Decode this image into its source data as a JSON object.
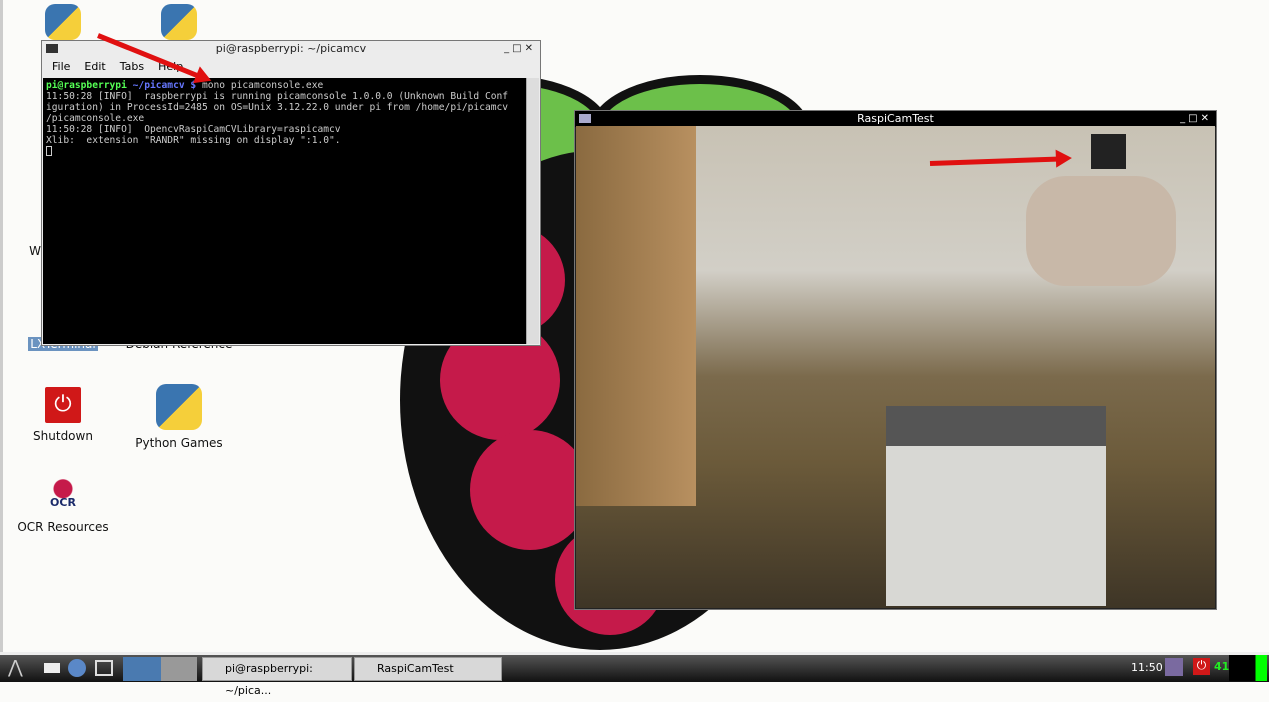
{
  "desktop": {
    "icons": [
      {
        "label": "W"
      },
      {
        "label": "LXTerminal"
      },
      {
        "label": "Debian Reference"
      },
      {
        "label": "Shutdown"
      },
      {
        "label": "Python Games"
      },
      {
        "label": "OCR Resources"
      }
    ]
  },
  "terminal": {
    "title": "pi@raspberrypi: ~/picamcv",
    "menu": [
      "File",
      "Edit",
      "Tabs",
      "Help"
    ],
    "prompt_user": "pi@raspberrypi",
    "prompt_path": " ~/picamcv $",
    "command": " mono picamconsole.exe",
    "lines": [
      "11:50:28 [INFO]  raspberrypi is running picamconsole 1.0.0.0 (Unknown Build Conf",
      "iguration) in ProcessId=2485 on OS=Unix 3.12.22.0 under pi from /home/pi/picamcv",
      "/picamconsole.exe",
      "11:50:28 [INFO]  OpencvRaspiCamCVLibrary=raspicamcv",
      "Xlib:  extension \"RANDR\" missing on display \":1.0\"."
    ]
  },
  "camwin": {
    "title": "RaspiCamTest"
  },
  "taskbar": {
    "tasks": [
      "pi@raspberrypi: ~/pica...",
      "RaspiCamTest"
    ],
    "clock": "11:50",
    "cpu": "41"
  },
  "colors": {
    "arrow": "#e01010",
    "raspberry": "#c51a4a",
    "leaf": "#6cc04a"
  }
}
